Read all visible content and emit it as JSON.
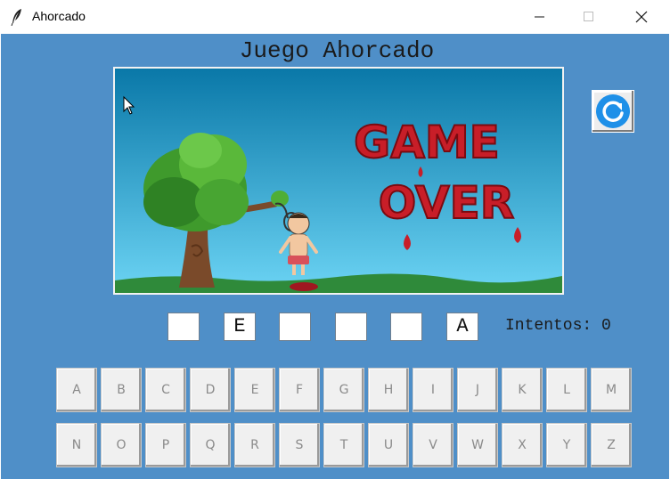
{
  "window": {
    "title": "Ahorcado",
    "icon": "feather-icon",
    "controls": [
      "minimize-icon",
      "maximize-icon",
      "close-icon"
    ]
  },
  "game": {
    "title": "Juego Ahorcado",
    "scene": {
      "status_text_line1": "GAME",
      "status_text_line2": "OVER"
    },
    "reset_icon": "refresh-icon",
    "word_slots": [
      "",
      "E",
      "",
      "",
      "",
      "A"
    ],
    "attempts_text": "Intentos: 0"
  },
  "keyboard": {
    "row1": [
      "A",
      "B",
      "C",
      "D",
      "E",
      "F",
      "G",
      "H",
      "I",
      "J",
      "K",
      "L",
      "M"
    ],
    "row2": [
      "N",
      "O",
      "P",
      "Q",
      "R",
      "S",
      "T",
      "U",
      "V",
      "W",
      "X",
      "Y",
      "Z"
    ]
  },
  "colors": {
    "background": "#4f8fc8",
    "reset_icon": "#1e90e8",
    "game_over_text": "#c81e28",
    "sky_top": "#0a78a8",
    "sky_bottom": "#6cd4f4"
  }
}
